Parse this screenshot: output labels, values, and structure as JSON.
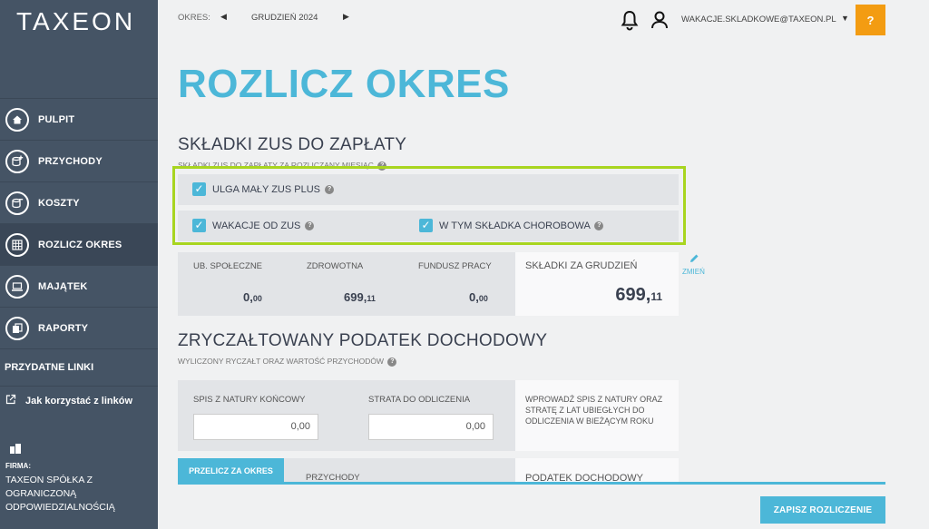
{
  "app": {
    "logo": "TAXEON"
  },
  "sidebar": {
    "items": [
      {
        "label": "PULPIT",
        "icon": "home-icon"
      },
      {
        "label": "PRZYCHODY",
        "icon": "coins-plus-icon"
      },
      {
        "label": "KOSZTY",
        "icon": "coins-minus-icon"
      },
      {
        "label": "ROZLICZ OKRES",
        "icon": "calculator-icon",
        "active": true
      },
      {
        "label": "MAJĄTEK",
        "icon": "laptop-icon"
      },
      {
        "label": "RAPORTY",
        "icon": "reports-icon"
      }
    ],
    "links_heading": "PRZYDATNE LINKI",
    "link": "Jak korzystać z linków",
    "firm_label": "FIRMA:",
    "firm_name": "TAXEON SPÓŁKA Z OGRANICZONĄ ODPOWIEDZIALNOŚCIĄ"
  },
  "topbar": {
    "period_label": "OKRES:",
    "period_value": "GRUDZIEŃ 2024",
    "email": "WAKACJE.SKLADKOWE@TAXEON.PL",
    "help": "?"
  },
  "main": {
    "title": "ROZLICZ OKRES",
    "zus_section": {
      "title": "SKŁADKI ZUS DO ZAPŁATY",
      "subtitle": "SKŁADKI ZUS DO ZAPŁATY ZA ROZLICZANY MIESIĄC",
      "checkboxes": {
        "ulga": "ULGA MAŁY ZUS PLUS",
        "wakacje": "WAKACJE OD ZUS",
        "chorobowa": "W TYM SKŁADKA CHOROBOWA"
      },
      "columns": {
        "spoleczne_label": "UB. SPOŁECZNE",
        "spoleczne_int": "0,",
        "spoleczne_dec": "00",
        "zdrowotna_label": "ZDROWOTNA",
        "zdrowotna_int": "699,",
        "zdrowotna_dec": "11",
        "fundusz_label": "FUNDUSZ PRACY",
        "fundusz_int": "0,",
        "fundusz_dec": "00"
      },
      "total_label": "SKŁADKI ZA GRUDZIEŃ",
      "total_int": "699,",
      "total_dec": "11",
      "change": "ZMIEŃ"
    },
    "tax_section": {
      "title": "ZRYCZAŁTOWANY PODATEK DOCHODOWY",
      "subtitle": "WYLICZONY RYCZAŁT ORAZ WARTOŚĆ PRZYCHODÓW",
      "spis_label": "SPIS Z NATURY KOŃCOWY",
      "spis_value": "0,00",
      "strata_label": "STRATA DO ODLICZENIA",
      "strata_value": "0,00",
      "note": "WPROWADŹ SPIS Z NATURY ORAZ STRATĘ Z LAT UBIEGŁYCH DO ODLICZENIA W BIEŻĄCYM ROKU"
    },
    "bottom": {
      "recalc": "PRZELICZ ZA OKRES",
      "przychody": "PRZYCHODY",
      "podatek": "PODATEK DOCHODOWY"
    },
    "save": "ZAPISZ ROZLICZENIE"
  },
  "colors": {
    "accent": "#4cb7d8",
    "sidebar": "#455465",
    "help": "#f39c12",
    "highlight": "#a8d520"
  }
}
